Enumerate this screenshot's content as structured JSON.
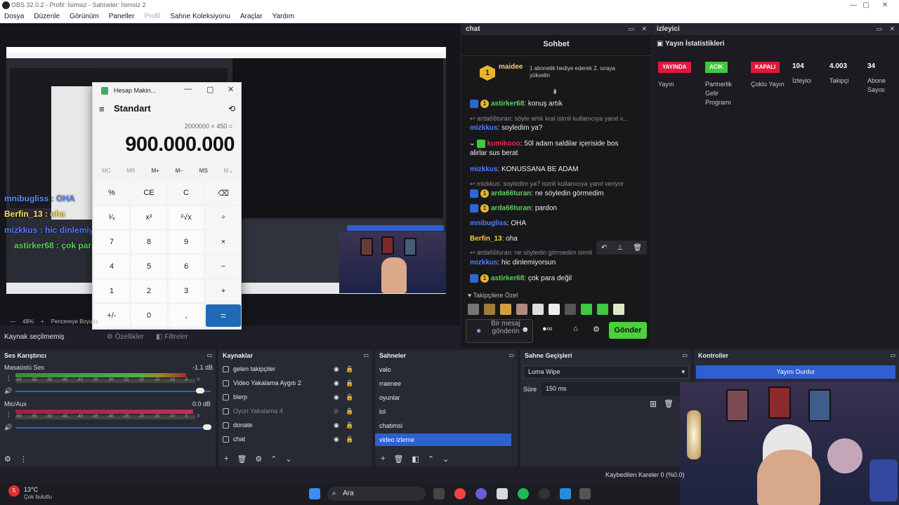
{
  "window": {
    "title": "OBS 32.0.2 - Profil: İsimsiz - Sahneler: İsimsiz 2",
    "min": "—",
    "max": "▢",
    "close": "✕"
  },
  "menu": [
    "Dosya",
    "Düzenle",
    "Görünüm",
    "Paneller",
    "Profil",
    "Sahne Koleksiyonu",
    "Araçlar",
    "Yardım"
  ],
  "calculator": {
    "title": "Hesap Makin...",
    "mode": "Standart",
    "expression": "2000000 × 450 =",
    "display": "900.000.000",
    "memory": [
      "MC",
      "MR",
      "M+",
      "M−",
      "MS",
      "M⌄"
    ],
    "keys": [
      "%",
      "CE",
      "C",
      "⌫",
      "¹⁄ₓ",
      "x²",
      "²√x",
      "÷",
      "7",
      "8",
      "9",
      "×",
      "4",
      "5",
      "6",
      "−",
      "1",
      "2",
      "3",
      "+",
      "+/-",
      "0",
      ",",
      "="
    ]
  },
  "preview_overlay": [
    {
      "text": "mnibugliss : OHA",
      "color": "#5b8cff"
    },
    {
      "text": "Berfin_13 : oha",
      "color": "#ffe066"
    },
    {
      "text": "mizkkus : hic dinlemiyorsun",
      "color": "#4f7cff"
    },
    {
      "text": "astirker68 : çok para değil",
      "color": "#5bd15b"
    }
  ],
  "preview_bottom": {
    "zoom": "48%",
    "zoom_plus": "+",
    "fit": "Pencereye Boyutla"
  },
  "chat": {
    "panel_title": "chat",
    "title": "Sohbet",
    "gift": {
      "user": "maidee",
      "rank": "1",
      "text": "1 abonelik hediye ederek 2. sıraya yükselin"
    },
    "messages": [
      {
        "user": "astirker68",
        "text": "konuş artık",
        "color": "#5bd15b"
      },
      {
        "reply": "arda66turan: söyle artık kral isimli kullanıcıya yanıt v..."
      },
      {
        "user": "mizkkus",
        "text": "soyledim ya?",
        "color": "#4f7cff"
      },
      {
        "user": "kumikooo",
        "text": "50l adam saldilar içeriside bos",
        "color": "#e02c4a"
      },
      {
        "text2": "alirlar sus berat"
      },
      {
        "user": "mizkkus",
        "text": "KONUSSANA BE ADAM",
        "color": "#4f7cff"
      },
      {
        "reply": "mizkkus: soyledim ya? isimli kullanıcıya yanıt veriyor"
      },
      {
        "user": "arda66turan",
        "text": "ne söyledin görmedim",
        "color": "#5bd15b"
      },
      {
        "user": "arda66turan",
        "text": "pardon",
        "color": "#5bd15b"
      },
      {
        "user": "mnibugliss",
        "text": "OHA",
        "color": "#4f7cff"
      },
      {
        "user": "Berfin_13",
        "text": "oha",
        "color": "#ffcc33"
      },
      {
        "reply": "arda66turan: ne söyledin görmedim isimli"
      },
      {
        "user": "mizkkus",
        "text": "hic dinlemiyorsun",
        "color": "#4f7cff"
      },
      {
        "user": "astirker68",
        "text": "çok para değil",
        "color": "#5bd15b"
      }
    ],
    "followers_label": "Takipçilere Özel",
    "input_placeholder": "Bir mesaj gönderin",
    "send": "Gönder"
  },
  "stats": {
    "panel_title": "izleyici",
    "title": "Yayın İstatistikleri",
    "tags": [
      {
        "label": "YAYINDA",
        "color": "#e0183c",
        "caption": "Yayın"
      },
      {
        "label": "ACIK",
        "color": "#3ec93e",
        "caption": "Partnerlik Gelir Programı"
      },
      {
        "label": "KAPALI",
        "color": "#e0183c",
        "caption": "Çoklu Yayın"
      }
    ],
    "numbers": [
      {
        "value": "104",
        "caption": "İzleyici"
      },
      {
        "value": "4.003",
        "caption": "Takipçi"
      },
      {
        "value": "34",
        "caption": "Abone Sayısı"
      }
    ]
  },
  "status": {
    "source": "Kaynak seçilmemiş",
    "props": "Özellikler",
    "filters": "Filtreler"
  },
  "mixer": {
    "title": "Ses Karıştırıcı",
    "channels": [
      {
        "name": "Masaüstü Ses",
        "db": "-1.1 dB",
        "level": 0.95
      },
      {
        "name": "Mic/Aux",
        "db": "0.0 dB",
        "level": 0.99
      }
    ],
    "scale": [
      "-60",
      "-55",
      "-50",
      "-45",
      "-40",
      "-35",
      "-30",
      "-25",
      "-20",
      "-15",
      "-10",
      "-5",
      "0"
    ]
  },
  "sources": {
    "title": "Kaynaklar",
    "items": [
      {
        "name": "gelen takipçiler",
        "hidden": false
      },
      {
        "name": "Video Yakalama Aygıtı 2",
        "hidden": false
      },
      {
        "name": "blerp",
        "hidden": false
      },
      {
        "name": "Oyun Yakalama 4",
        "hidden": true
      },
      {
        "name": "donate",
        "hidden": false
      },
      {
        "name": "chat",
        "hidden": false
      }
    ]
  },
  "scenes": {
    "title": "Sahneler",
    "items": [
      "valo",
      "rraenee",
      "oyunlar",
      "lol",
      "chatimsi",
      "video izleme"
    ],
    "selected": "video izleme"
  },
  "transitions": {
    "title": "Sahne Geçişleri",
    "type": "Luma Wipe",
    "duration_label": "Süre",
    "duration": "150 ms"
  },
  "controls": {
    "title": "Kontroller",
    "stop": "Yayını Durdur"
  },
  "dropped": "Kaybedilen Kareler 0 (%0.0)",
  "taskbar": {
    "temp": "13°C",
    "weather": "Çok bulutlu",
    "search": "Ara",
    "notif": "5"
  }
}
